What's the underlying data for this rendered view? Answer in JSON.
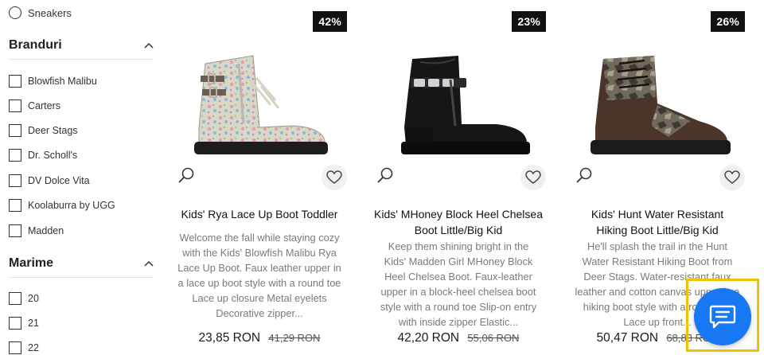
{
  "sidebar": {
    "type_option": "Sneakers",
    "brands_title": "Branduri",
    "brands": [
      "Blowfish Malibu",
      "Carters",
      "Deer Stags",
      "Dr. Scholl's",
      "DV Dolce Vita",
      "Koolaburra by UGG",
      "Madden"
    ],
    "size_title": "Marime",
    "sizes": [
      "20",
      "21",
      "22"
    ]
  },
  "products": [
    {
      "badge": "42%",
      "title_lines": [
        "Kids' Rya Lace Up Boot Toddler"
      ],
      "desc_lines": [
        "Welcome the fall while staying cozy",
        "with the Kids' Blowfish Malibu Rya",
        "Lace Up Boot. Faux leather upper in",
        "a lace up boot style with a round toe",
        "Lace up closure Metal eyelets",
        "Decorative zipper..."
      ],
      "price": "23,85 RON",
      "old_price": "41,29 RON"
    },
    {
      "badge": "23%",
      "title_lines": [
        "Kids' MHoney Block Heel Chelsea",
        "Boot Little/Big Kid"
      ],
      "desc_lines": [
        "Keep them shining bright in the",
        "Kids' Madden Girl MHoney Block",
        "Heel Chelsea Boot. Faux-leather",
        "upper in a block-heel chelsea boot",
        "style with a round toe Slip-on entry",
        "with inside zipper Elastic..."
      ],
      "price": "42,20 RON",
      "old_price": "55,06 RON"
    },
    {
      "badge": "26%",
      "title_lines": [
        "Kids' Hunt Water Resistant",
        "Hiking Boot Little/Big Kid"
      ],
      "desc_lines": [
        "He'll splash the trail in the Hunt",
        "Water Resistant Hiking Boot from",
        "Deer Stags. Water-resistant faux",
        "leather and cotton canvas upper in a",
        "hiking boot style with a round toe",
        "Lace up front..."
      ],
      "price": "50,47 RON",
      "old_price": "68,83 RON"
    }
  ],
  "colors": {
    "chat": "#1877f2",
    "highlight": "#f2c200",
    "badge": "#111111"
  }
}
